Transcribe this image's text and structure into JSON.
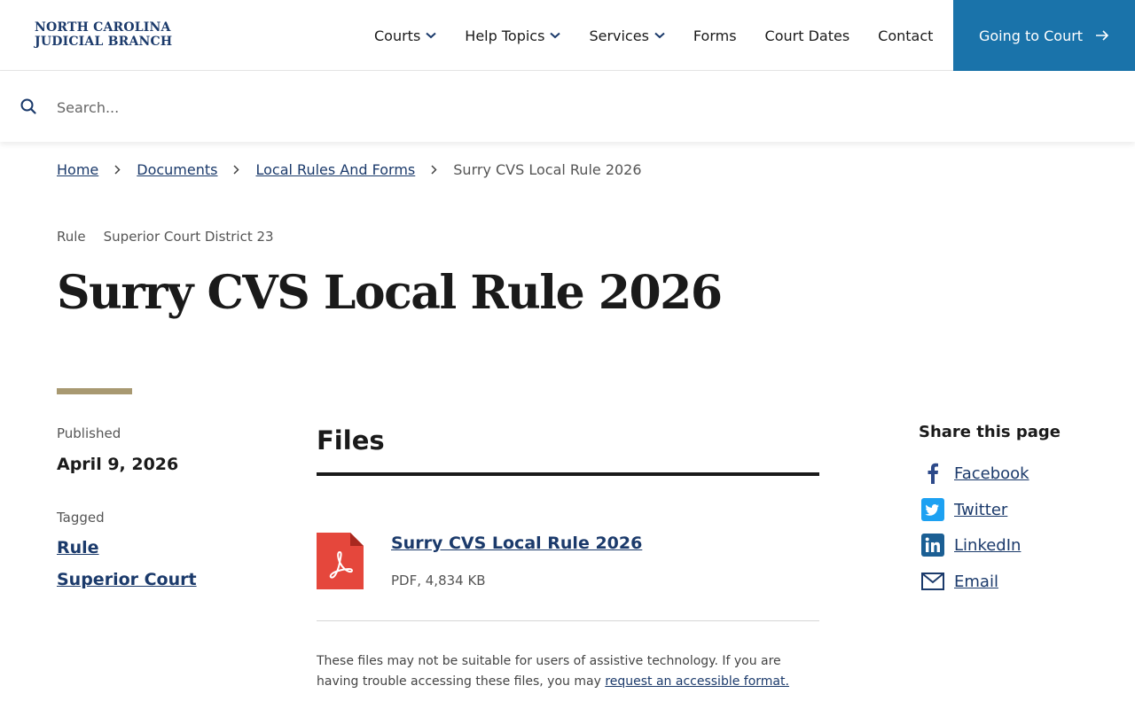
{
  "header": {
    "logo_line1": "NORTH CAROLINA",
    "logo_line2": "JUDICIAL BRANCH",
    "nav": [
      {
        "label": "Courts",
        "has_dropdown": true
      },
      {
        "label": "Help Topics",
        "has_dropdown": true
      },
      {
        "label": "Services",
        "has_dropdown": true
      },
      {
        "label": "Forms",
        "has_dropdown": false
      },
      {
        "label": "Court Dates",
        "has_dropdown": false
      },
      {
        "label": "Contact",
        "has_dropdown": false
      }
    ],
    "cta_label": "Going to Court",
    "cta_icon": "arrow-right-icon"
  },
  "search": {
    "placeholder": "Search...",
    "value": "",
    "icon": "search-icon"
  },
  "breadcrumb": {
    "items": [
      "Home",
      "Documents",
      "Local Rules And Forms"
    ],
    "current": "Surry CVS Local Rule 2026",
    "separator_icon": "chevron-right-icon"
  },
  "page": {
    "tags": [
      "Rule",
      "Superior Court District 23"
    ],
    "title": "Surry CVS Local Rule 2026"
  },
  "meta": {
    "published_label": "Published",
    "published_date": "April 9, 2026",
    "tagged_label": "Tagged",
    "tags": [
      "Rule",
      "Superior Court"
    ]
  },
  "files": {
    "heading": "Files",
    "items": [
      {
        "name": "Surry CVS Local Rule 2026",
        "info": "PDF, 4,834 KB",
        "icon": "pdf-file-icon"
      }
    ],
    "note_text": "These files may not be suitable for users of assistive technology. If you are having trouble accessing these files, you may ",
    "note_link": "request an accessible format."
  },
  "share": {
    "heading": "Share this page",
    "items": [
      {
        "label": "Facebook",
        "icon": "facebook-icon"
      },
      {
        "label": "Twitter",
        "icon": "twitter-icon"
      },
      {
        "label": "LinkedIn",
        "icon": "linkedin-icon"
      },
      {
        "label": "Email",
        "icon": "email-icon"
      }
    ]
  },
  "colors": {
    "brand_navy": "#1b3a6b",
    "cta_blue": "#1a73aa",
    "accent_gold": "#a89971",
    "pdf_red": "#e5473c",
    "twitter_blue": "#1da1f2",
    "facebook_blue": "#2d4a8a",
    "linkedin_blue": "#1b5f94"
  }
}
